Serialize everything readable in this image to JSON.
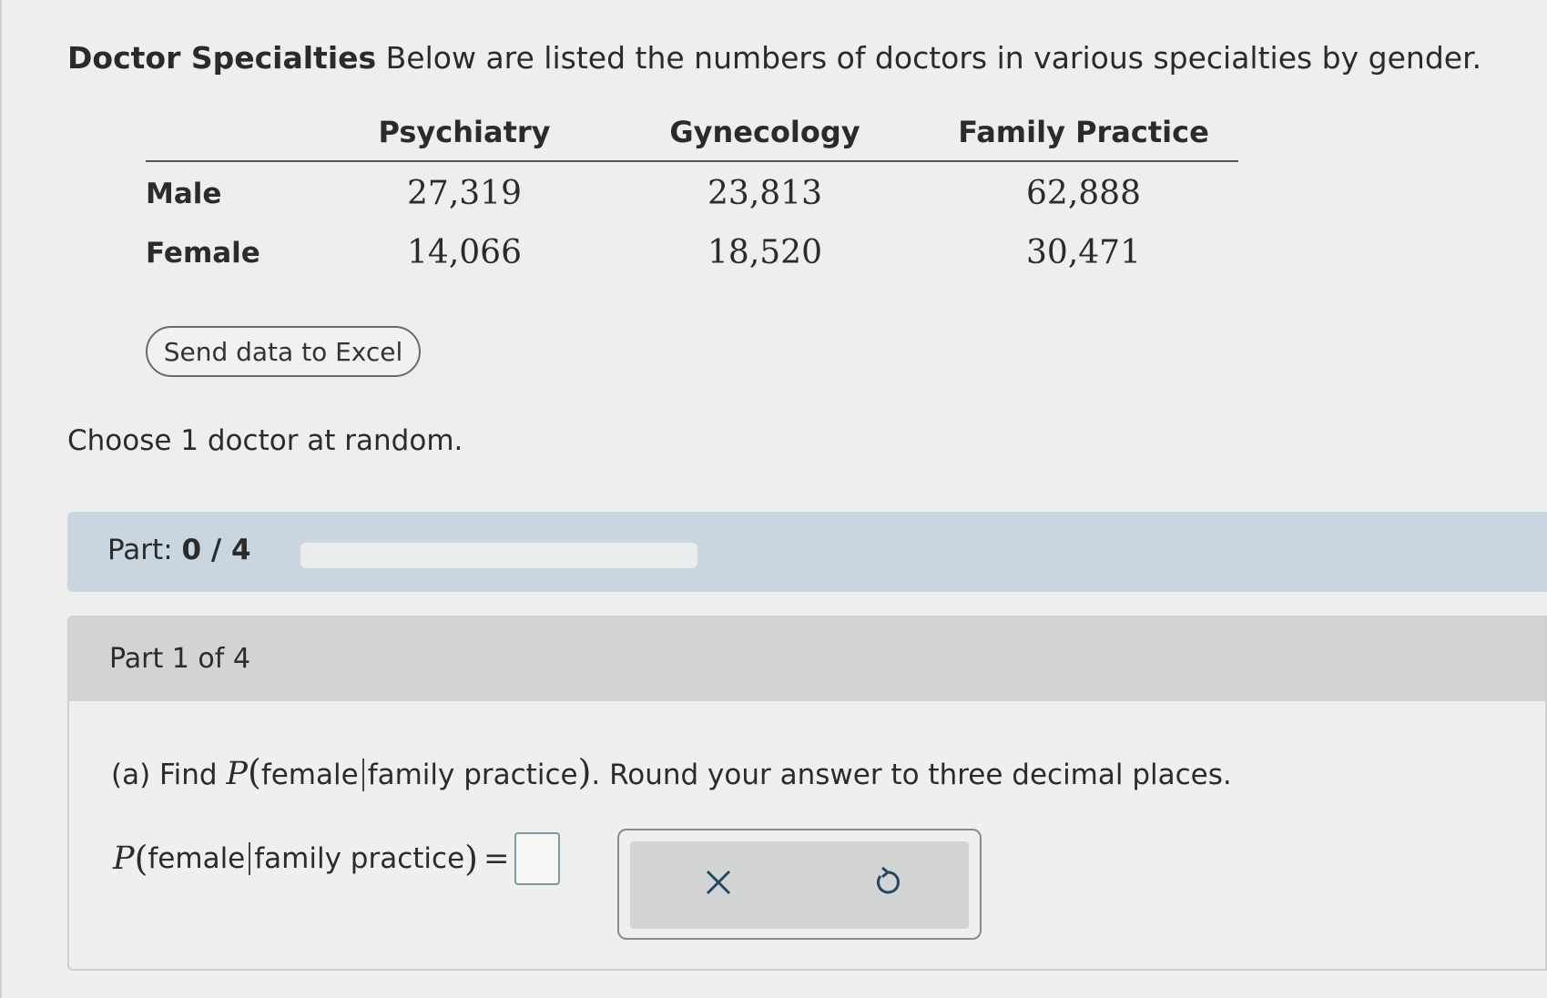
{
  "problem": {
    "title": "Doctor Specialties",
    "intro": "Below are listed the numbers of doctors in various specialties by gender."
  },
  "table": {
    "columns": [
      "Psychiatry",
      "Gynecology",
      "Family Practice"
    ],
    "rows": [
      {
        "label": "Male",
        "values": [
          "27,319",
          "23,813",
          "62,888"
        ]
      },
      {
        "label": "Female",
        "values": [
          "14,066",
          "18,520",
          "30,471"
        ]
      }
    ]
  },
  "excel_button": "Send data to Excel",
  "instruction": "Choose 1 doctor at random.",
  "progress": {
    "label": "Part:",
    "value": "0 / 4",
    "fraction": 0
  },
  "part": {
    "title": "Part 1 of 4",
    "question_prefix": "(a) Find",
    "prob_symbol": "P",
    "event": "female",
    "given": "family practice",
    "question_suffix": ". Round your answer to three decimal places.",
    "answer_value": ""
  },
  "tools": {
    "clear_icon": "close-icon",
    "undo_icon": "undo-icon"
  },
  "colors": {
    "progress_band": "#c9d6df",
    "part_header": "#d3d4d2",
    "icon": "#1f4a60"
  }
}
